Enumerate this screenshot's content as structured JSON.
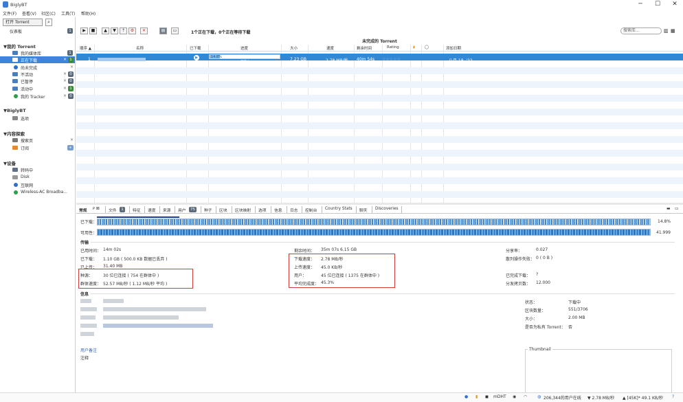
{
  "window": {
    "title": "BiglyBT",
    "minimize": "─",
    "maximize": "☐",
    "close": "✕"
  },
  "menu": [
    "文件(F)",
    "查看(V)",
    "社区(C)",
    "工具(T)",
    "帮助(H)"
  ],
  "sidebar": {
    "open_torrent": "打开 Torrent",
    "dashboard": "仪表板",
    "dashboard_badge": "1",
    "section_torrent": "▼我的 Torrent",
    "items": [
      {
        "label": "我的媒体库",
        "badge": "1"
      },
      {
        "label": "正在下载",
        "badge": "1"
      },
      {
        "label": "尚未完成"
      },
      {
        "label": "不活动",
        "badge": "0"
      },
      {
        "label": "已暂停",
        "badge": "0"
      },
      {
        "label": "活动中",
        "badge": "1"
      },
      {
        "label": "我的 Tracker",
        "badge": "0"
      }
    ],
    "section_biglybt": "▼BiglyBT",
    "biglybt_items": [
      "选项"
    ],
    "section_content": "▼内容探索",
    "content_items": [
      "搜索页",
      "订阅"
    ],
    "section_devices": "▼设备",
    "device_items": [
      "转码中",
      "Disk",
      "互联网",
      "Wireless-AC Broadba..."
    ]
  },
  "toolbar": {
    "status": "1个正在下载，0个正在等待下载",
    "search_placeholder": "搜索库..."
  },
  "table": {
    "title": "未完成的 Torrent",
    "columns": [
      "顺序 ▲",
      "名称",
      "已下载",
      "进度",
      "大小",
      "速度",
      "剩余时间",
      "Rating",
      "",
      "",
      "添加日期"
    ],
    "row": {
      "order": "1",
      "progress_pct": "14.8%",
      "progress_state": "下载中",
      "size": "7.23 GB",
      "speed": "2.78 MB/秒",
      "eta": "40m 54s",
      "rating": "☆☆☆☆☆",
      "added": "八月 18, '22",
      "progress_value": 0.148
    }
  },
  "tabs": [
    "常规",
    "文件",
    "特征",
    "速度",
    "来源",
    "用户",
    "种子",
    "区块",
    "区块映射",
    "选项",
    "信息",
    "日志",
    "控制台",
    "Country Stats",
    "聊天",
    "Discoveries"
  ],
  "tab_badges": {
    "files": "1",
    "users": "75"
  },
  "general": {
    "downloaded_label": "已下载：",
    "downloaded_pct": "14.8%",
    "availability_label": "可用性：",
    "availability_val": "41.999",
    "transfer_title": "传输",
    "elapsed_label": "已用时间：",
    "elapsed_val": "14m 02s",
    "dl_label": "已下载：",
    "dl_val": "1.10 GB ( 500.0 KB 数据已丢弃 )",
    "ul_label": "已上传：",
    "ul_val": "31.40 MB",
    "seeds_label": "种源：",
    "seeds_val": "30 位已连接 ( 754 在群体中 )",
    "swarm_label": "群体速度：",
    "swarm_val": "52.57 MB/秒 ( 1.12 MB/秒 平均 )",
    "remaining_label": "剩余时间：",
    "remaining_val": "35m 07s 6.15 GB",
    "dlspeed_label": "下载速度：",
    "dlspeed_val": "2.78 MB/秒",
    "ulspeed_label": "上传速度：",
    "ulspeed_val": "45.0 KB/秒",
    "peers_label": "用户：",
    "peers_val": "45 位已连接 ( 1375 在群体中 )",
    "avgcomp_label": "平均完成度：",
    "avgcomp_val": "45.3%",
    "share_label": "分享率：",
    "share_val": "0.027",
    "hashfail_label": "散列操作失败：",
    "hashfail_val": "0 ( 0 B )",
    "reannounce_label": "已完成下载：",
    "reannounce_val": "?",
    "dist_label": "分发拷贝数：",
    "dist_val": "12.000",
    "info_title": "信息",
    "status_label": "状态：",
    "status_val": "下载中",
    "pieces_label": "区块数量：",
    "pieces_val": "551/3706",
    "size_label": "大小：",
    "size_val": "2.00 MB",
    "private_label": "是否为私有 Torrent：",
    "private_val": "否",
    "comment_label": "用户备注",
    "notes_label": "注释",
    "thumbnail": "Thumbnail"
  },
  "statusbar": {
    "dht": "mDHT",
    "users": "206,344的用户在线",
    "down": "▼ 2.78 MB/秒",
    "up": "▲ [45K]* 49.1 KB/秒"
  }
}
